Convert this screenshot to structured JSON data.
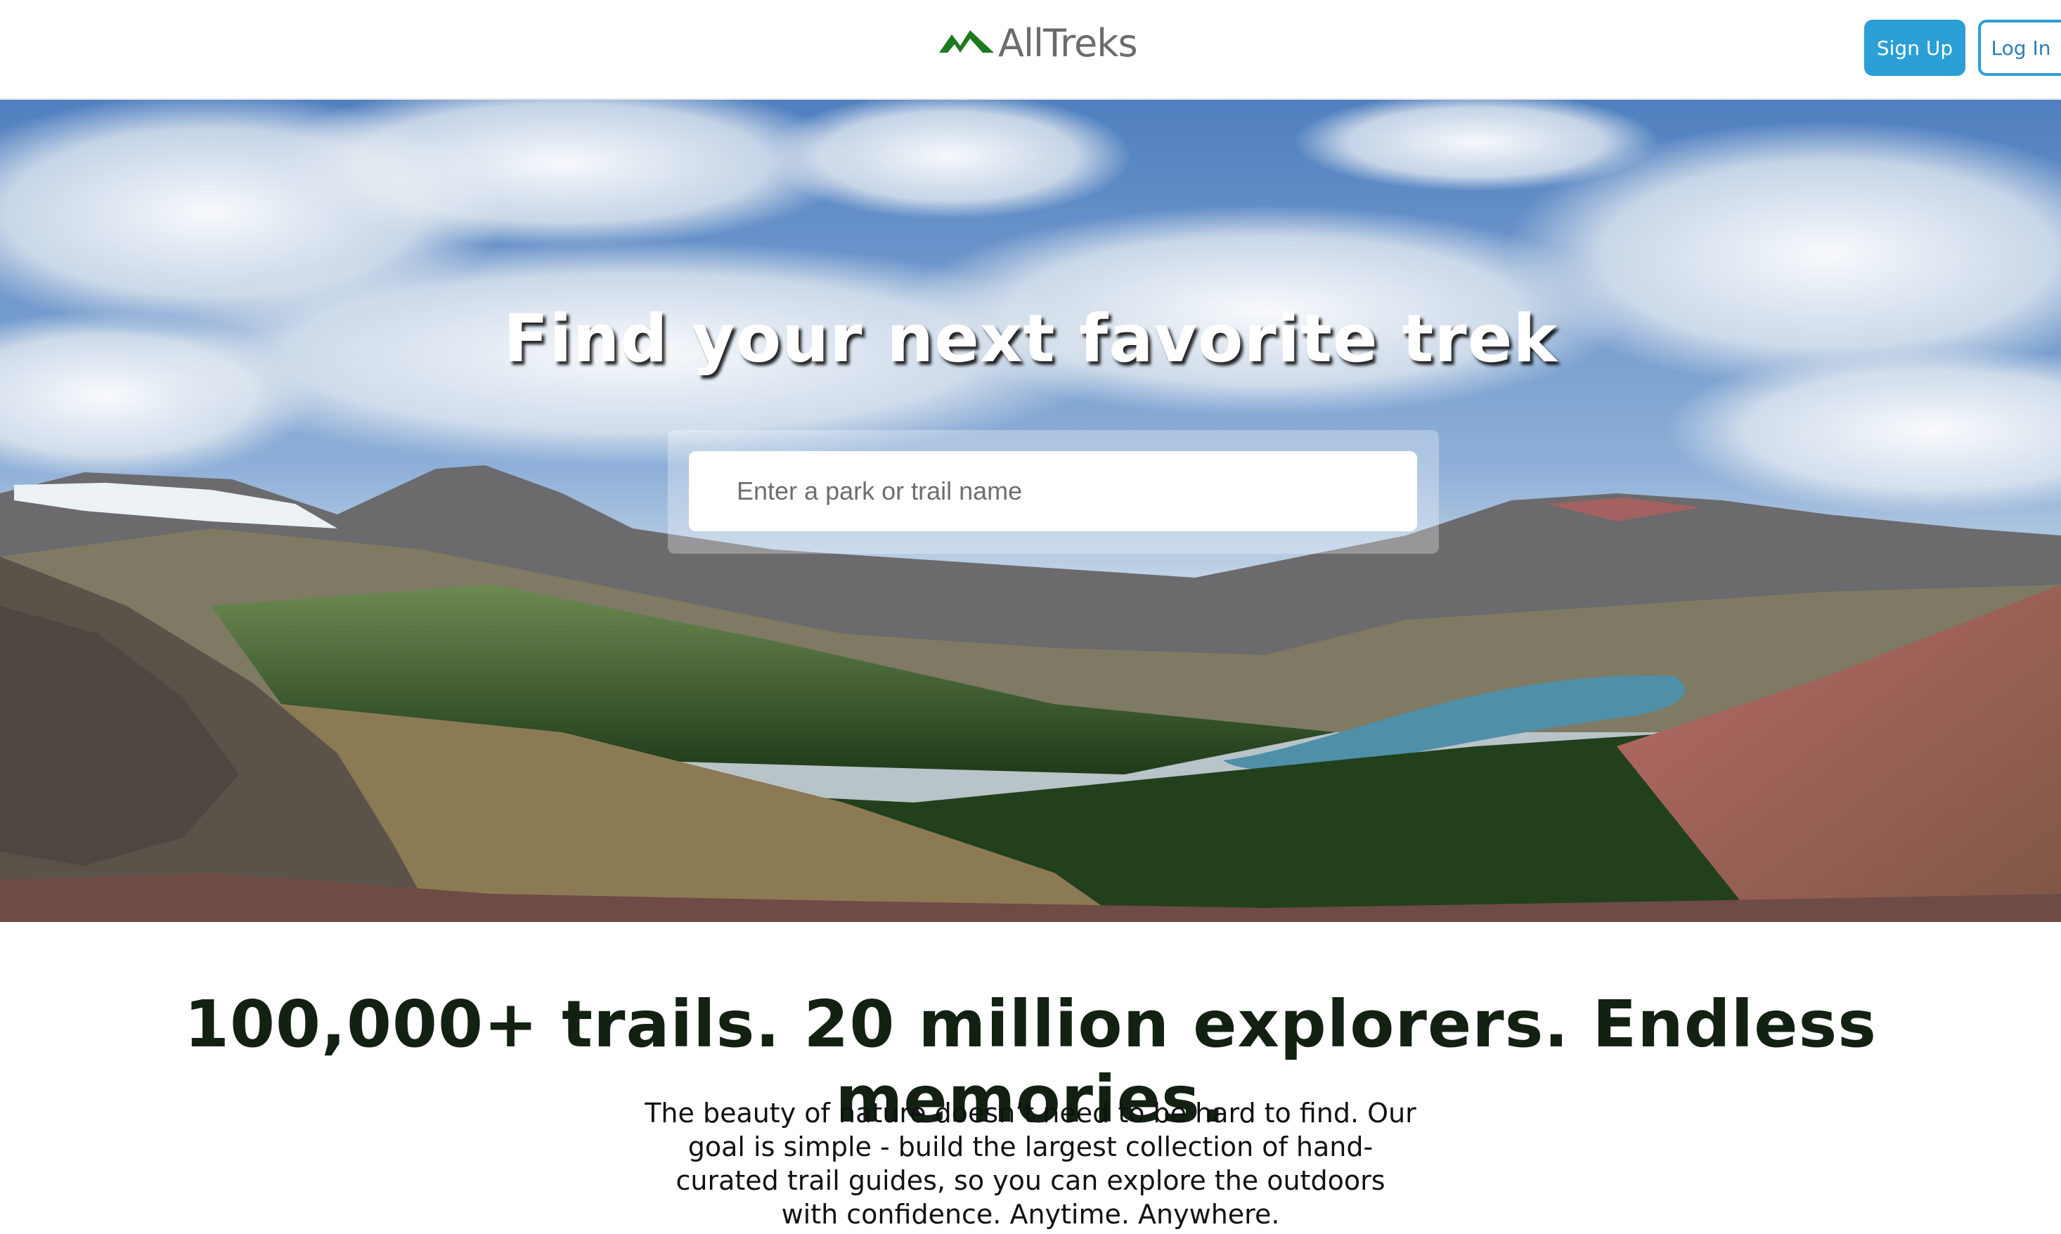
{
  "header": {
    "brand": "AllTreks",
    "signup_label": "Sign Up",
    "login_label": "Log In",
    "brand_color": "#1e7a1e",
    "accent_color": "#2b9fd6"
  },
  "hero": {
    "title": "Find your next favorite trek",
    "search": {
      "placeholder": "Enter a park or trail name",
      "value": ""
    }
  },
  "main": {
    "tagline": "100,000+ trails. 20 million explorers. Endless memories.",
    "description": "The beauty of nature doesn’t need to be hard to find. Our goal is simple - build the largest collection of hand-curated trail guides, so you can explore the outdoors with confidence. Anytime. Anywhere."
  },
  "icons": {
    "logo": "mountain-icon"
  }
}
